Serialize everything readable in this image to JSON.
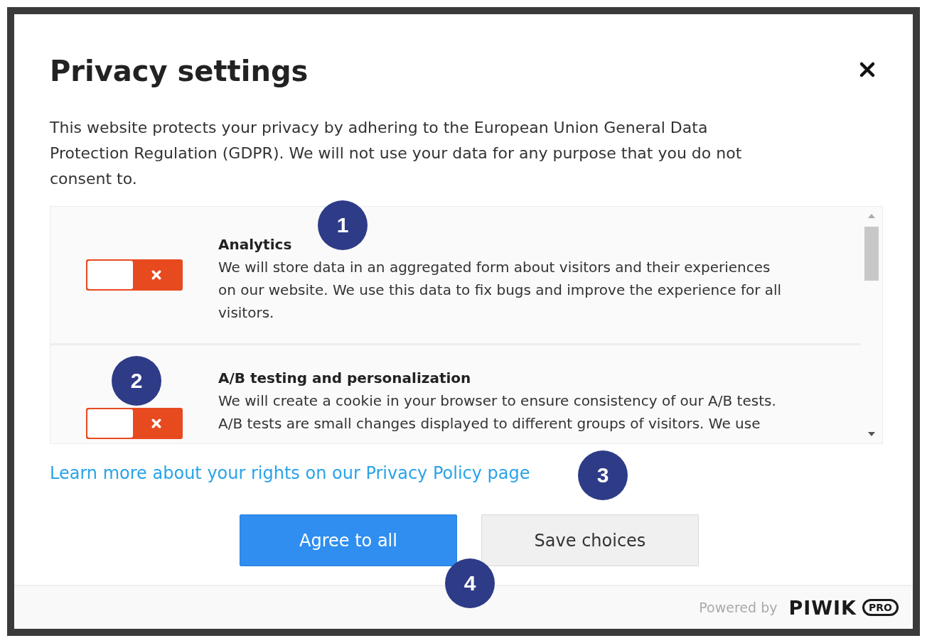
{
  "dialog": {
    "title": "Privacy settings",
    "intro": "This website protects your privacy by adhering to the European Union General Data Protection Regulation (GDPR). We will not use your data for any purpose that you do not consent to."
  },
  "consents": [
    {
      "title": "Analytics",
      "description": "We will store data in an aggregated form about visitors and their experiences on our website. We use this data to fix bugs and improve the experience for all visitors.",
      "on": false
    },
    {
      "title": "A/B testing and personalization",
      "description": "We will create a cookie in your browser to ensure consistency of our A/B tests. A/B tests are small changes displayed to different groups of visitors. We use",
      "on": false
    }
  ],
  "policy_link": "Learn more about your rights on our Privacy Policy page",
  "buttons": [
    {
      "label": "Agree to all",
      "kind": "primary"
    },
    {
      "label": "Save choices",
      "kind": "secondary"
    }
  ],
  "footer": {
    "powered_by": "Powered by",
    "brand": "PIWIK",
    "brand_badge": "PRO"
  },
  "callouts": [
    {
      "label": "1"
    },
    {
      "label": "2"
    },
    {
      "label": "3"
    },
    {
      "label": "4"
    }
  ]
}
